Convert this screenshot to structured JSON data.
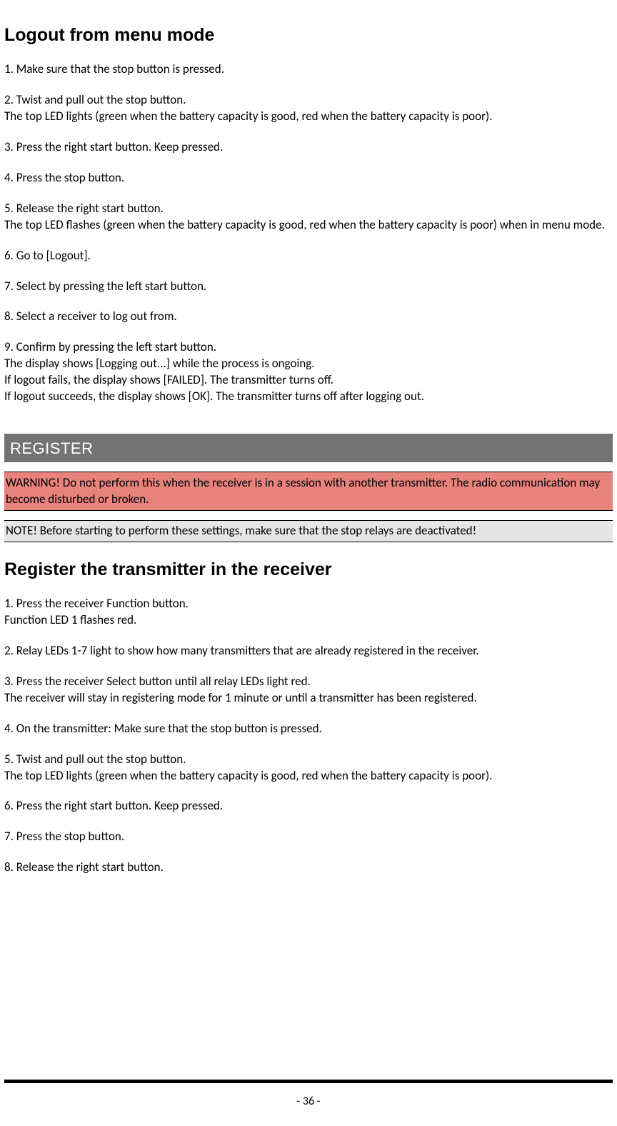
{
  "section1": {
    "heading": "Logout from menu mode",
    "paras": [
      [
        "1. Make sure that the stop button is pressed."
      ],
      [
        "2. Twist and pull out the stop button.",
        "The top LED lights (green when the battery capacity is good, red when the battery capacity is poor)."
      ],
      [
        "3. Press the right start button. Keep pressed."
      ],
      [
        "4. Press the stop button."
      ],
      [
        "5. Release the right start button.",
        "The top LED flashes (green when the battery capacity is good, red when the battery capacity is poor) when in menu mode."
      ],
      [
        "6. Go to [Logout]."
      ],
      [
        "7. Select by pressing the left start button."
      ],
      [
        "8. Select a receiver to log out from."
      ],
      [
        "9. Confirm by pressing the left start button.",
        "The display shows [Logging out...] while the process is ongoing.",
        "If logout fails, the display shows [FAILED]. The transmitter turns off.",
        "If logout succeeds, the display shows [OK]. The transmitter turns off after logging out."
      ]
    ]
  },
  "section_header": "REGISTER",
  "warning": "WARNING! Do not perform this when the receiver is in a session with another transmitter. The radio communication may become disturbed or broken.",
  "note": "NOTE! Before starting to perform these settings, make sure that the stop relays are deactivated!",
  "section2": {
    "heading": "Register the transmitter in the receiver",
    "paras": [
      [
        "1. Press the receiver Function button.",
        "Function LED 1 flashes red."
      ],
      [
        "2. Relay LEDs 1-7 light to show how many transmitters that are already registered in the receiver."
      ],
      [
        "3. Press the receiver Select button until all relay LEDs light red.",
        "The receiver will stay in registering mode for 1 minute or until a transmitter has been registered."
      ],
      [
        "4. On the transmitter: Make sure that the stop button is pressed."
      ],
      [
        "5. Twist and pull out the stop button.",
        "The top LED lights (green when the battery capacity is good, red when the battery capacity is poor)."
      ],
      [
        "6. Press the right start button. Keep pressed."
      ],
      [
        "7. Press the stop button."
      ],
      [
        "8. Release the right start button."
      ]
    ]
  },
  "page_number": "- 36 -"
}
